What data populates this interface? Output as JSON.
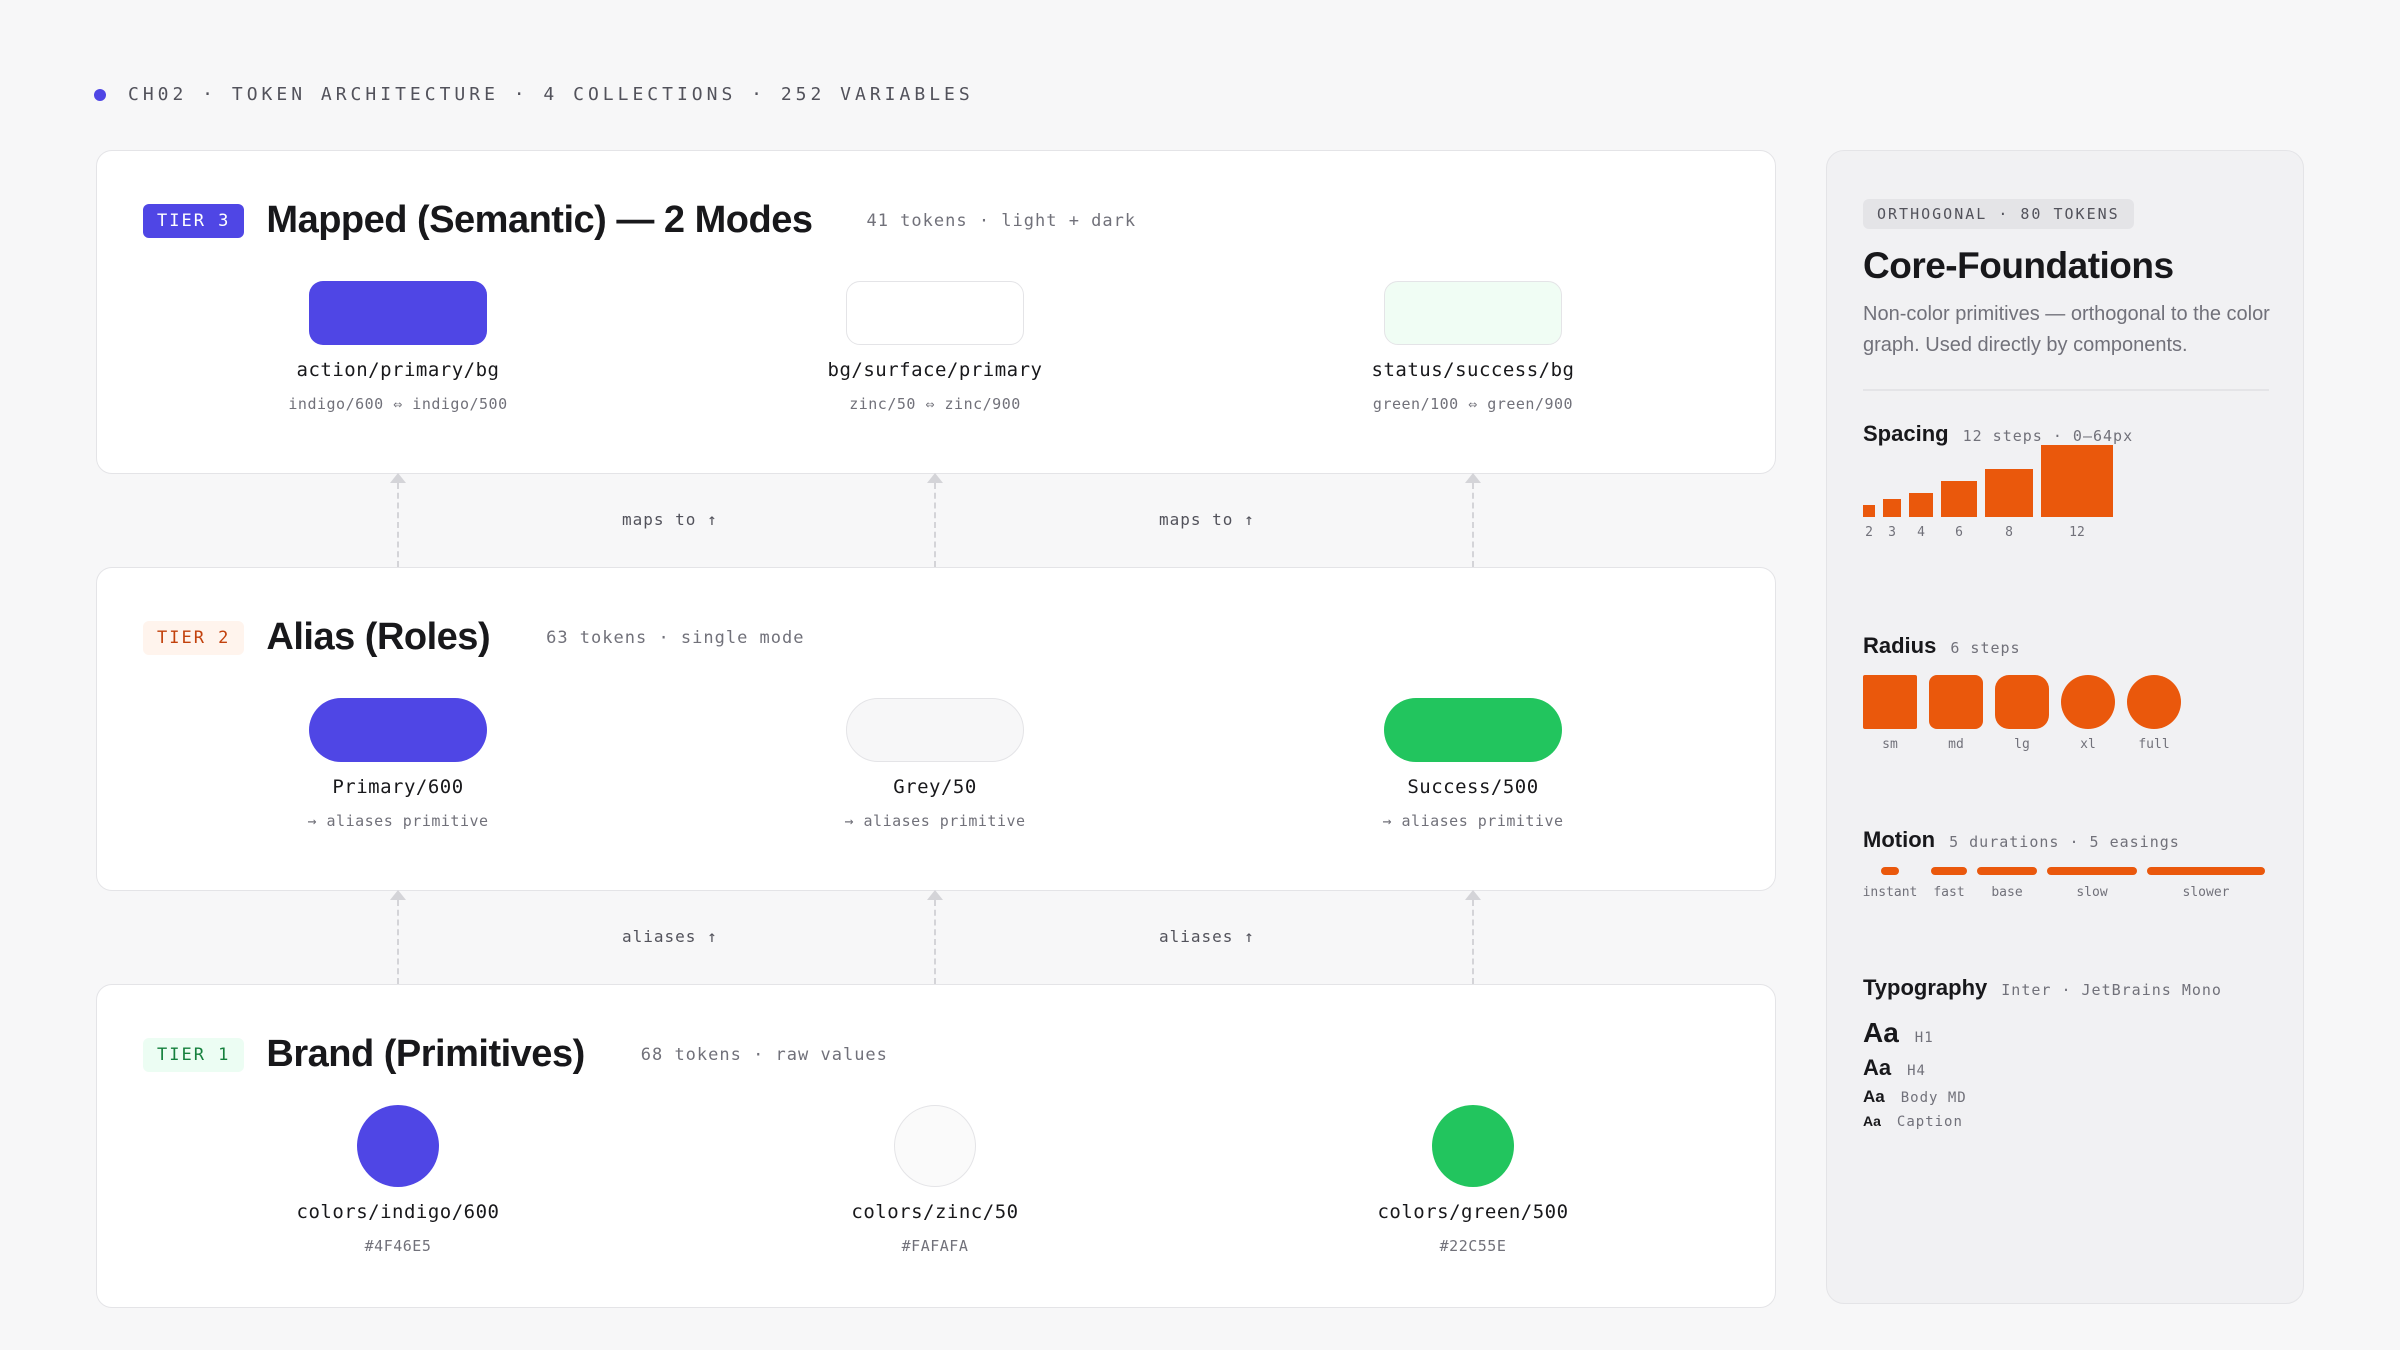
{
  "header": {
    "text": "CH02 · TOKEN ARCHITECTURE · 4 COLLECTIONS · 252 VARIABLES"
  },
  "tiers": [
    {
      "badge": "TIER 3",
      "title": "Mapped (Semantic) — 2 Modes",
      "meta": "41 tokens · light + dark",
      "tokens": [
        {
          "name": "action/primary/bg",
          "sub": "indigo/600 ⇔ indigo/500",
          "color": "#4F46E5"
        },
        {
          "name": "bg/surface/primary",
          "sub": "zinc/50 ⇔ zinc/900",
          "color": "#FFFFFF"
        },
        {
          "name": "status/success/bg",
          "sub": "green/100 ⇔ green/900",
          "color": "#F0FDF4"
        }
      ]
    },
    {
      "badge": "TIER 2",
      "title": "Alias (Roles)",
      "meta": "63 tokens · single mode",
      "tokens": [
        {
          "name": "Primary/600",
          "sub": "→ aliases primitive",
          "color": "#4F46E5"
        },
        {
          "name": "Grey/50",
          "sub": "→ aliases primitive",
          "color": "#F7F7F8"
        },
        {
          "name": "Success/500",
          "sub": "→ aliases primitive",
          "color": "#22C55E"
        }
      ]
    },
    {
      "badge": "TIER 1",
      "title": "Brand (Primitives)",
      "meta": "68 tokens · raw values",
      "tokens": [
        {
          "name": "colors/indigo/600",
          "sub": "#4F46E5",
          "color": "#4F46E5"
        },
        {
          "name": "colors/zinc/50",
          "sub": "#FAFAFA",
          "color": "#FAFAFA"
        },
        {
          "name": "colors/green/500",
          "sub": "#22C55E",
          "color": "#22C55E"
        }
      ]
    }
  ],
  "connectors": {
    "upper": [
      "maps to ↑",
      "maps to ↑"
    ],
    "lower": [
      "aliases ↑",
      "aliases ↑"
    ]
  },
  "panel": {
    "badge": "ORTHOGONAL · 80 TOKENS",
    "title": "Core-Foundations",
    "description": "Non-color primitives — orthogonal to the color graph. Used directly by components.",
    "spacing": {
      "title": "Spacing",
      "meta": "12 steps · 0–64px",
      "steps": [
        "2",
        "3",
        "4",
        "6",
        "8",
        "12"
      ],
      "values": [
        2,
        3,
        4,
        6,
        8,
        12
      ]
    },
    "radius": {
      "title": "Radius",
      "meta": "6 steps",
      "steps": [
        "sm",
        "md",
        "lg",
        "xl",
        "full"
      ]
    },
    "motion": {
      "title": "Motion",
      "meta": "5 durations · 5 easings",
      "steps": [
        "instant",
        "fast",
        "base",
        "slow",
        "slower"
      ]
    },
    "typography": {
      "title": "Typography",
      "meta": "Inter · JetBrains Mono",
      "rows": [
        {
          "sample": "Aa",
          "label": "H1"
        },
        {
          "sample": "Aa",
          "label": "H4"
        },
        {
          "sample": "Aa",
          "label": "Body MD"
        },
        {
          "sample": "Aa",
          "label": "Caption"
        }
      ]
    }
  },
  "colors": {
    "accent": "#4F46E5",
    "orange": "#EA580C",
    "green": "#22C55E"
  }
}
